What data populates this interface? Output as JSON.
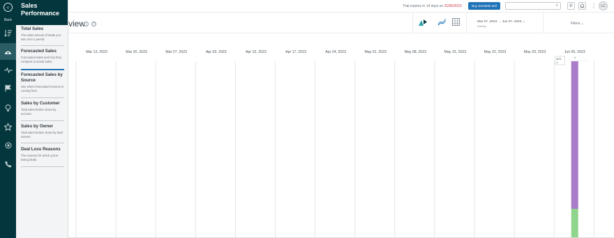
{
  "nav": {
    "back_label": "Back",
    "back_icon": "chevron-left-icon",
    "icons": [
      "list-sort-icon",
      "dashboard-gauge-icon",
      "pulse-icon",
      "flag-icon",
      "lightbulb-icon",
      "star-icon",
      "settings-dial-icon",
      "phone-icon"
    ]
  },
  "panel": {
    "title": "Sales Performance",
    "items": [
      {
        "title": "Total Sales",
        "desc": "The sales amount of deals you won over a period."
      },
      {
        "title": "Forecasted Sales",
        "desc": "Forecasted sales and how they compare to actual sales."
      },
      {
        "title": "Forecasted Sales by Source",
        "desc": "See where forecasted revenue is coming from."
      },
      {
        "title": "Sales by Customer",
        "desc": "Total sales broken down by account."
      },
      {
        "title": "Sales by Owner",
        "desc": "Total sales broken down by deal owners."
      },
      {
        "title": "Deal Loss Reasons",
        "desc": "The reasons for which you're losing deals."
      }
    ]
  },
  "topbar": {
    "trial_prefix": "Trial expires in 14 days on",
    "trial_date": "21/06/2023",
    "buy_label": "Buy Zendesk Sell",
    "search_placeholder": "",
    "avatar_initials": "LC"
  },
  "header": {
    "title_fragment": "view",
    "date_range": "Mar 07, 2023 → Jun 07, 2023",
    "granularity": "Weekly",
    "filters_label": "Filters"
  },
  "chart_data": {
    "type": "bar",
    "categories": [
      "Mar 13, 2023",
      "Mar 20, 2023",
      "Mar 27, 2023",
      "Apr 03, 2023",
      "Apr 10, 2023",
      "Apr 17, 2023",
      "Apr 24, 2023",
      "May 01, 2023",
      "May 08, 2023",
      "May 15, 2023",
      "May 22, 2023",
      "May 29, 2023",
      "Jun 05, 2023"
    ],
    "series": [
      {
        "color": "#a97bc9",
        "values": [
          0,
          0,
          0,
          0,
          0,
          0,
          0,
          0,
          0,
          0,
          0,
          0,
          212
        ]
      },
      {
        "color": "#8fd58b",
        "values": [
          0,
          0,
          0,
          0,
          0,
          0,
          0,
          0,
          0,
          0,
          0,
          0,
          42
        ]
      }
    ],
    "tooltip_label": "AVG",
    "tooltip_sub": "4",
    "bar_top_label": "4",
    "ymax": 254,
    "grid": true
  }
}
